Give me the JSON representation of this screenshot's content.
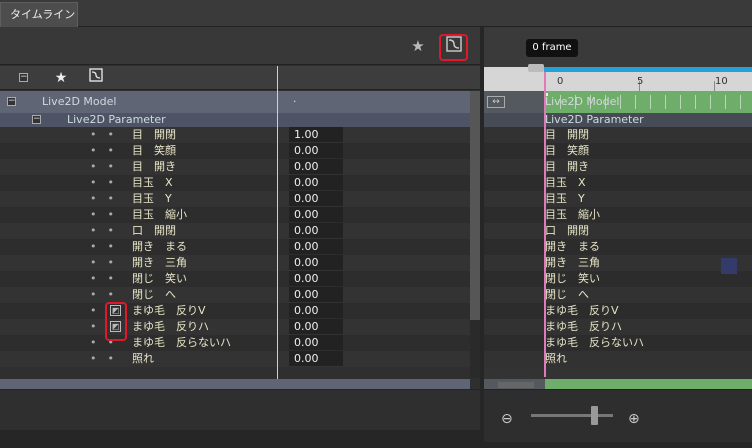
{
  "tabs": {
    "timeline": "タイムライン"
  },
  "toolbar": {
    "star_icon": "star-icon",
    "graph_icon": "graph-editor-icon"
  },
  "tree": {
    "model_label": "Live2D Model",
    "model_value": "·",
    "group_label": "Live2D Parameter",
    "params": [
      {
        "label": "目　開閉",
        "value": "1.00"
      },
      {
        "label": "目　笑顔",
        "value": "0.00"
      },
      {
        "label": "目　開き",
        "value": "0.00"
      },
      {
        "label": "目玉　X",
        "value": "0.00"
      },
      {
        "label": "目玉　Y",
        "value": "0.00"
      },
      {
        "label": "目玉　縮小",
        "value": "0.00"
      },
      {
        "label": "口　開閉",
        "value": "0.00"
      },
      {
        "label": "開き　まる",
        "value": "0.00"
      },
      {
        "label": "開き　三角",
        "value": "0.00"
      },
      {
        "label": "閉じ　笑い",
        "value": "0.00"
      },
      {
        "label": "閉じ　へ",
        "value": "0.00"
      },
      {
        "label": "まゆ毛　反りV",
        "value": "0.00"
      },
      {
        "label": "まゆ毛　反りハ",
        "value": "0.00"
      },
      {
        "label": "まゆ毛　反らないハ",
        "value": "0.00"
      },
      {
        "label": "照れ",
        "value": "0.00"
      }
    ]
  },
  "timeline": {
    "frame_tooltip": "0 frame",
    "ticks": [
      "0",
      "5",
      "10"
    ],
    "model_label": "Live2D Model",
    "group_label": "Live2D Parameter",
    "track_labels": [
      "目　開閉",
      "目　笑顔",
      "目　開き",
      "目玉　X",
      "目玉　Y",
      "目玉　縮小",
      "口　開閉",
      "開き　まる",
      "開き　三角",
      "閉じ　笑い",
      "閉じ　へ",
      "まゆ毛　反りV",
      "まゆ毛　反りハ",
      "まゆ毛　反らないハ",
      "照れ"
    ]
  },
  "zoom": {
    "out_icon": "zoom-out-icon",
    "in_icon": "zoom-in-icon",
    "level": 0.75
  }
}
